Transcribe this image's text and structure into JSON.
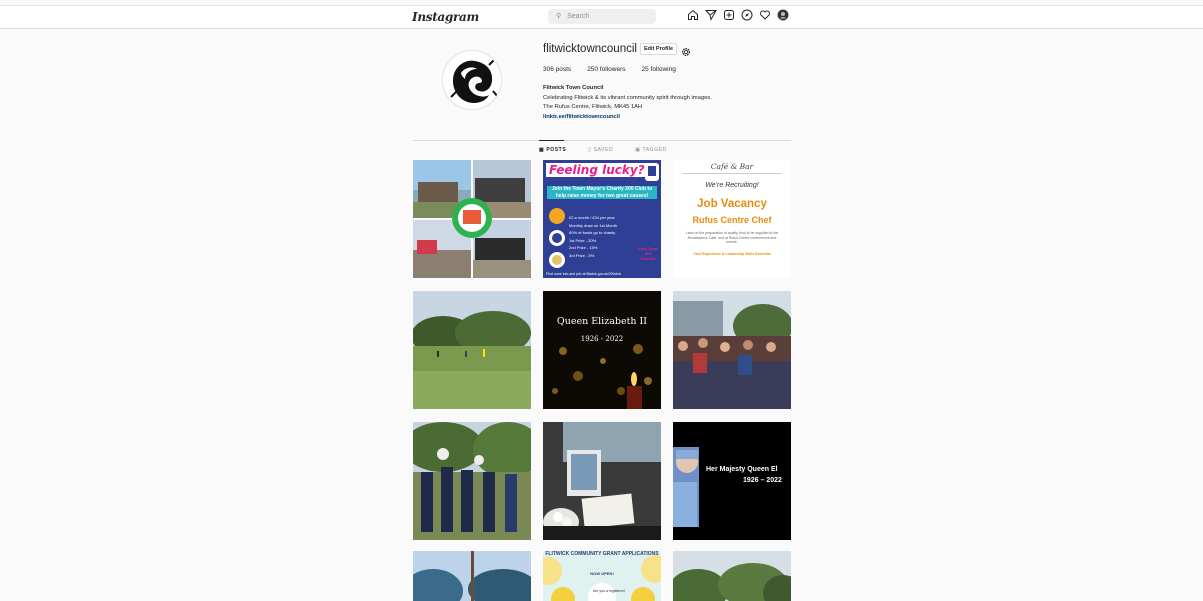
{
  "header": {
    "logo": "Instagram",
    "search_placeholder": "Search",
    "icons": [
      "home-icon",
      "direct-icon",
      "new-post-icon",
      "explore-icon",
      "activity-icon",
      "profile-avatar-icon"
    ]
  },
  "profile": {
    "username": "flitwicktowncouncil",
    "edit_label": "Edit Profile",
    "posts": "306 posts",
    "followers": "250 followers",
    "following": "25 following",
    "name": "Flitwick Town Council",
    "bio1": "Celebrating Flitwick & its vibrant community spirit through images.",
    "bio2": "The Rufus Centre, Flitwick, MK45 1AH",
    "link": "linktr.ee/flitwicktowncouncil"
  },
  "tabs": {
    "posts": "POSTS",
    "saved": "SAVED",
    "tagged": "TAGGED"
  },
  "posts": {
    "lucky_title": "Feeling lucky?",
    "lucky_sub": "Join the Town Mayor's Charity 200 Club to help raise money for two great causes!",
    "lucky_l1": "£2 a month / £24 per year",
    "lucky_l2": "Monthly draw on 1st Month",
    "lucky_l3": "60% of funds go to charity",
    "lucky_l4": "1st Prize - 20%",
    "lucky_l5": "2nd Prize - 15%",
    "lucky_l6": "3rd Prize - 5%",
    "lucky_badge": "First Draw 3rd October",
    "lucky_foot": "Find more info and join at flitwick.gov.uk/200club",
    "job_cafe": "Café & Bar",
    "job_recruit": "We're Recruiting!",
    "job_vacancy": "Job Vacancy",
    "job_role": "Rufus Centre Chef",
    "job_desc": "Lead on the preparation of quality food to be supplied to the Renaissance Café, and at Rufus Centre conferences and events.",
    "job_req": "Chef Experience & Leadership Skills Essential",
    "queen_title": "Queen Elizabeth II",
    "queen_dates": "1926 - 2022",
    "hm_title": "Her Majesty Queen El",
    "hm_dates": "1926 – 2022",
    "grant_title": "FLITWICK COMMUNITY GRANT APPLICATIONS",
    "grant_open": "NOW OPEN!",
    "grant_q": "Are you a registered"
  }
}
